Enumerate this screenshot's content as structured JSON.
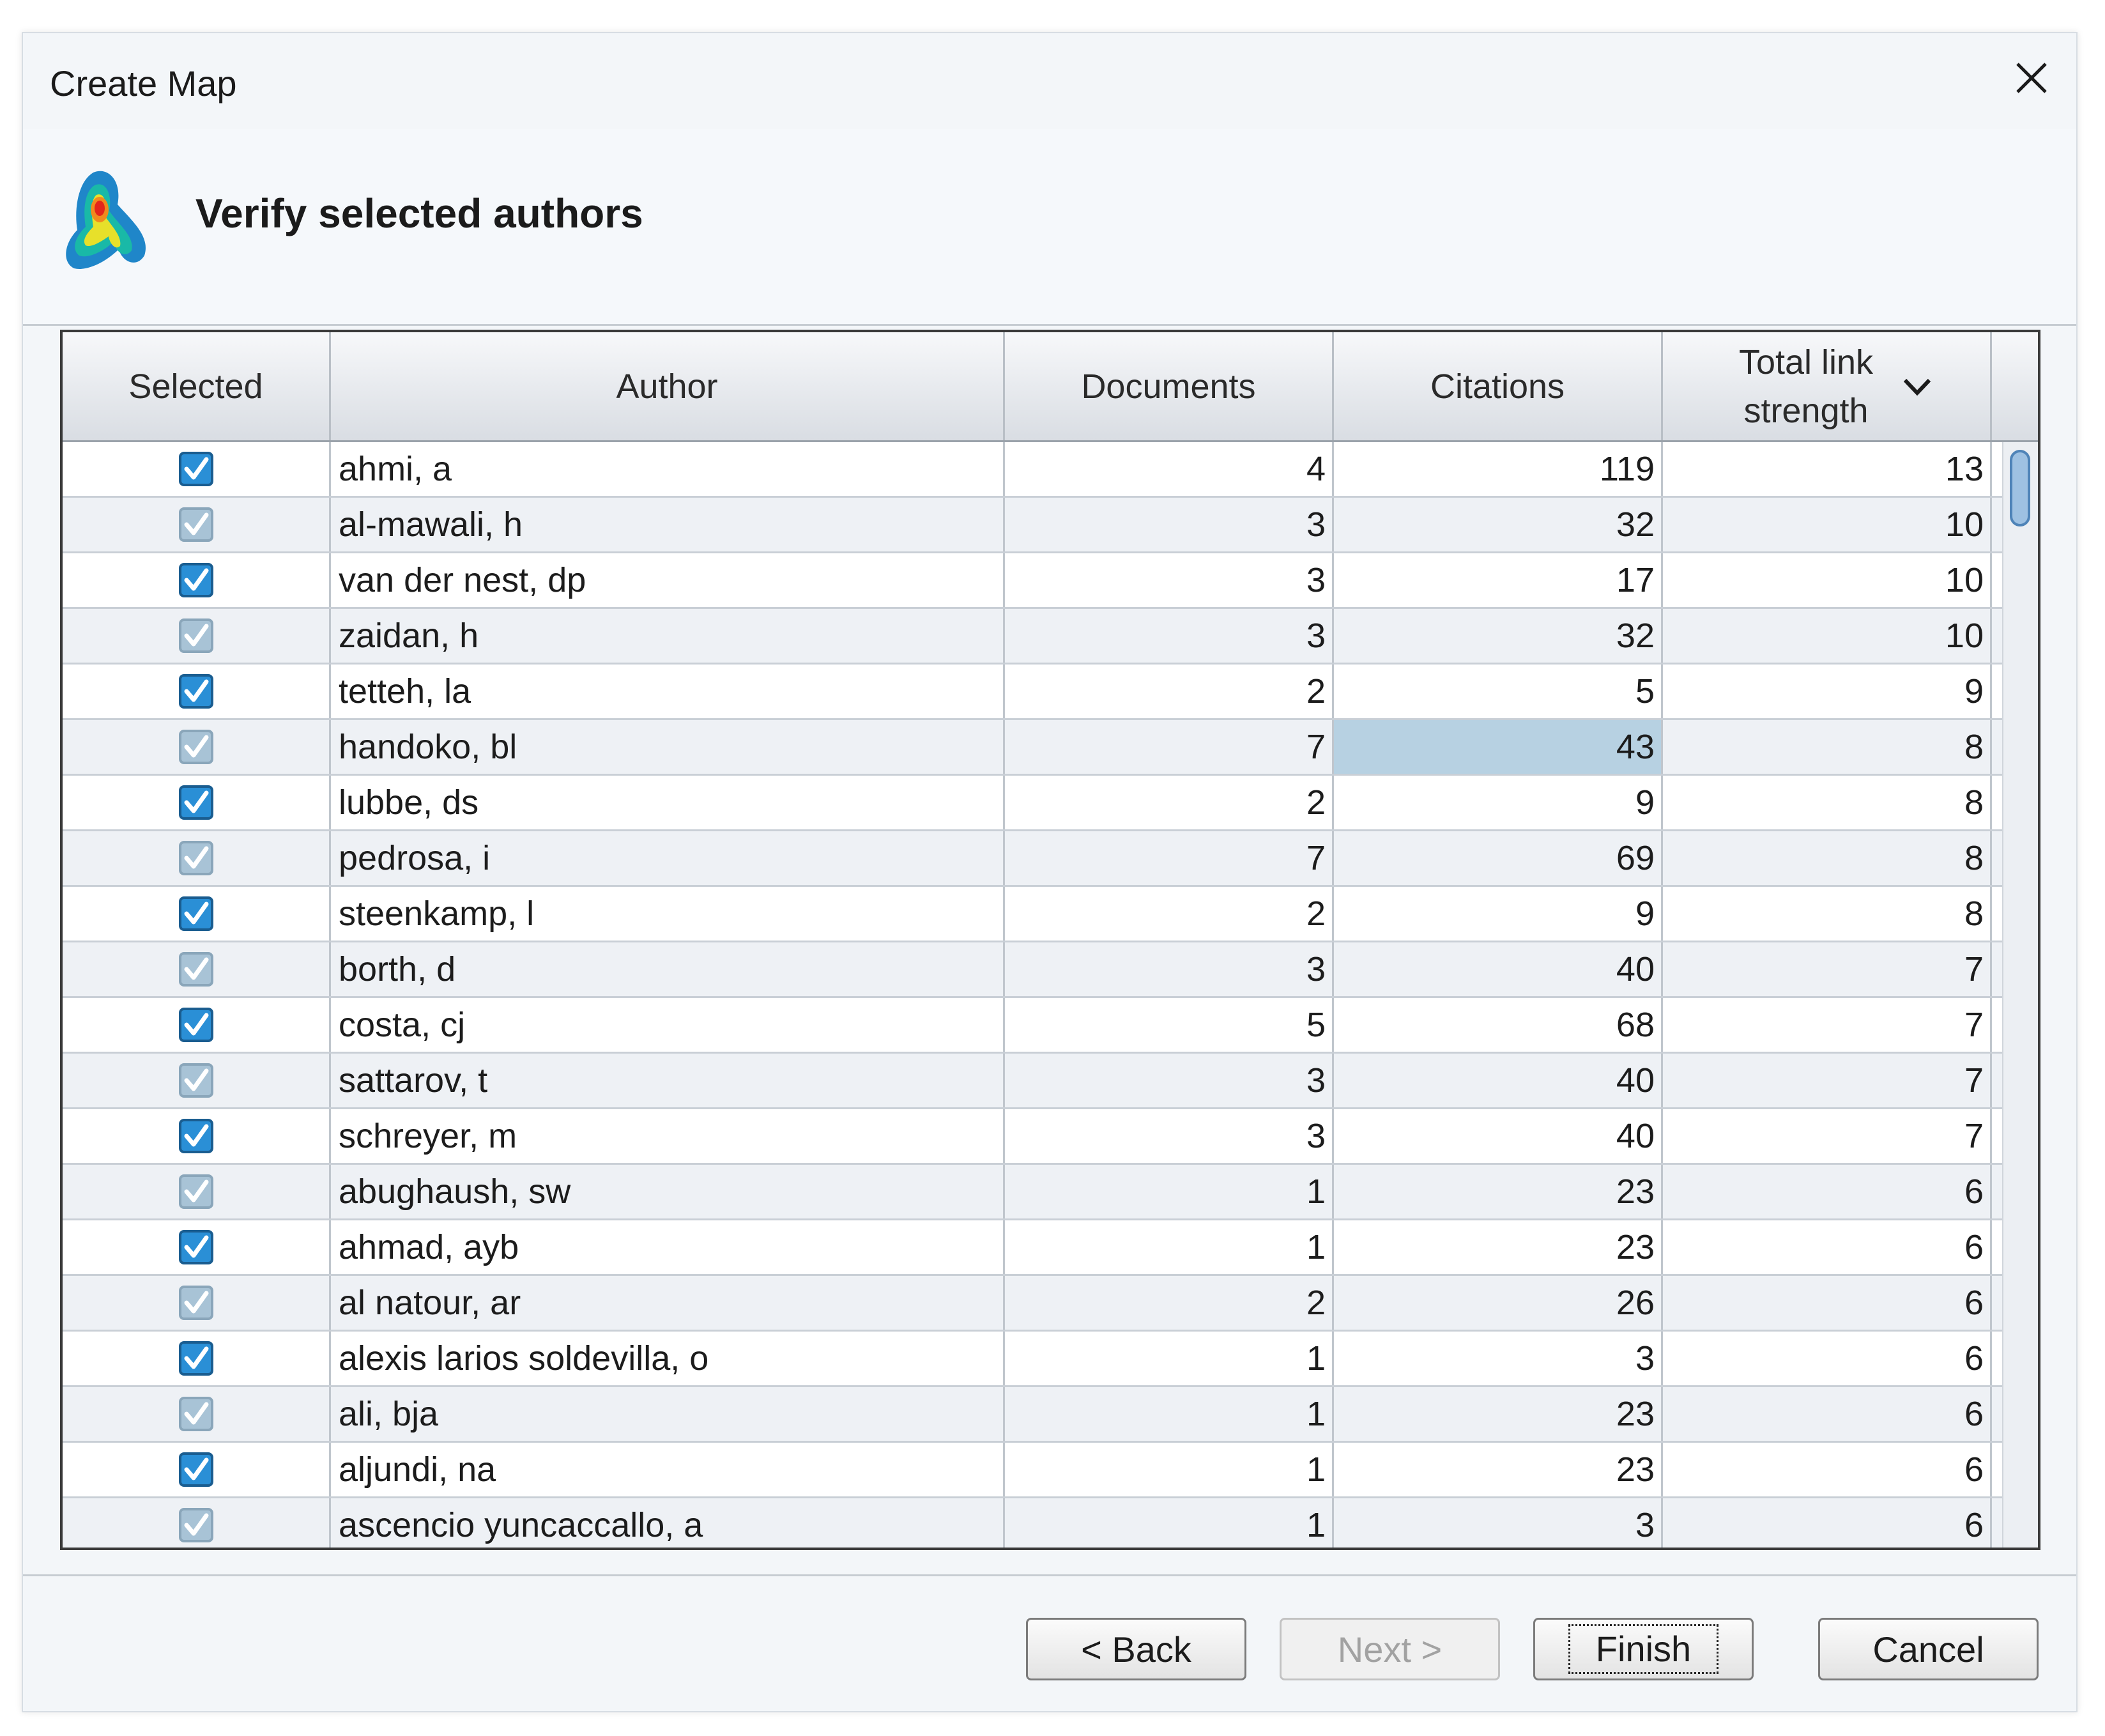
{
  "window": {
    "title": "Create Map",
    "close_icon": "close-icon"
  },
  "header": {
    "heading": "Verify selected authors",
    "logo_icon": "vosviewer-logo-icon"
  },
  "table": {
    "columns": {
      "selected": "Selected",
      "author": "Author",
      "documents": "Documents",
      "citations": "Citations",
      "total_link_strength": "Total link strength",
      "sort_icon": "chevron-down-icon"
    },
    "rows": [
      {
        "selected": true,
        "author": "ahmi, a",
        "documents": "4",
        "citations": "119",
        "tls": "13"
      },
      {
        "selected": true,
        "author": "al-mawali, h",
        "documents": "3",
        "citations": "32",
        "tls": "10"
      },
      {
        "selected": true,
        "author": "van der nest, dp",
        "documents": "3",
        "citations": "17",
        "tls": "10"
      },
      {
        "selected": true,
        "author": "zaidan, h",
        "documents": "3",
        "citations": "32",
        "tls": "10"
      },
      {
        "selected": true,
        "author": "tetteh, la",
        "documents": "2",
        "citations": "5",
        "tls": "9"
      },
      {
        "selected": true,
        "author": "handoko, bl",
        "documents": "7",
        "citations": "43",
        "tls": "8"
      },
      {
        "selected": true,
        "author": "lubbe, ds",
        "documents": "2",
        "citations": "9",
        "tls": "8"
      },
      {
        "selected": true,
        "author": "pedrosa, i",
        "documents": "7",
        "citations": "69",
        "tls": "8"
      },
      {
        "selected": true,
        "author": "steenkamp, l",
        "documents": "2",
        "citations": "9",
        "tls": "8"
      },
      {
        "selected": true,
        "author": "borth, d",
        "documents": "3",
        "citations": "40",
        "tls": "7"
      },
      {
        "selected": true,
        "author": "costa, cj",
        "documents": "5",
        "citations": "68",
        "tls": "7"
      },
      {
        "selected": true,
        "author": "sattarov, t",
        "documents": "3",
        "citations": "40",
        "tls": "7"
      },
      {
        "selected": true,
        "author": "schreyer, m",
        "documents": "3",
        "citations": "40",
        "tls": "7"
      },
      {
        "selected": true,
        "author": "abughaush, sw",
        "documents": "1",
        "citations": "23",
        "tls": "6"
      },
      {
        "selected": true,
        "author": "ahmad, ayb",
        "documents": "1",
        "citations": "23",
        "tls": "6"
      },
      {
        "selected": true,
        "author": "al natour, ar",
        "documents": "2",
        "citations": "26",
        "tls": "6"
      },
      {
        "selected": true,
        "author": "alexis larios soldevilla, o",
        "documents": "1",
        "citations": "3",
        "tls": "6"
      },
      {
        "selected": true,
        "author": "ali, bja",
        "documents": "1",
        "citations": "23",
        "tls": "6"
      },
      {
        "selected": true,
        "author": "aljundi, na",
        "documents": "1",
        "citations": "23",
        "tls": "6"
      },
      {
        "selected": true,
        "author": "ascencio yuncaccallo, a",
        "documents": "1",
        "citations": "3",
        "tls": "6"
      }
    ],
    "highlighted_cell": {
      "row": 5,
      "column": "citations"
    }
  },
  "buttons": {
    "back": "< Back",
    "next": "Next >",
    "finish": "Finish",
    "cancel": "Cancel"
  },
  "colors": {
    "accent": "#2a8fd6",
    "selection": "#b7d1e2"
  }
}
